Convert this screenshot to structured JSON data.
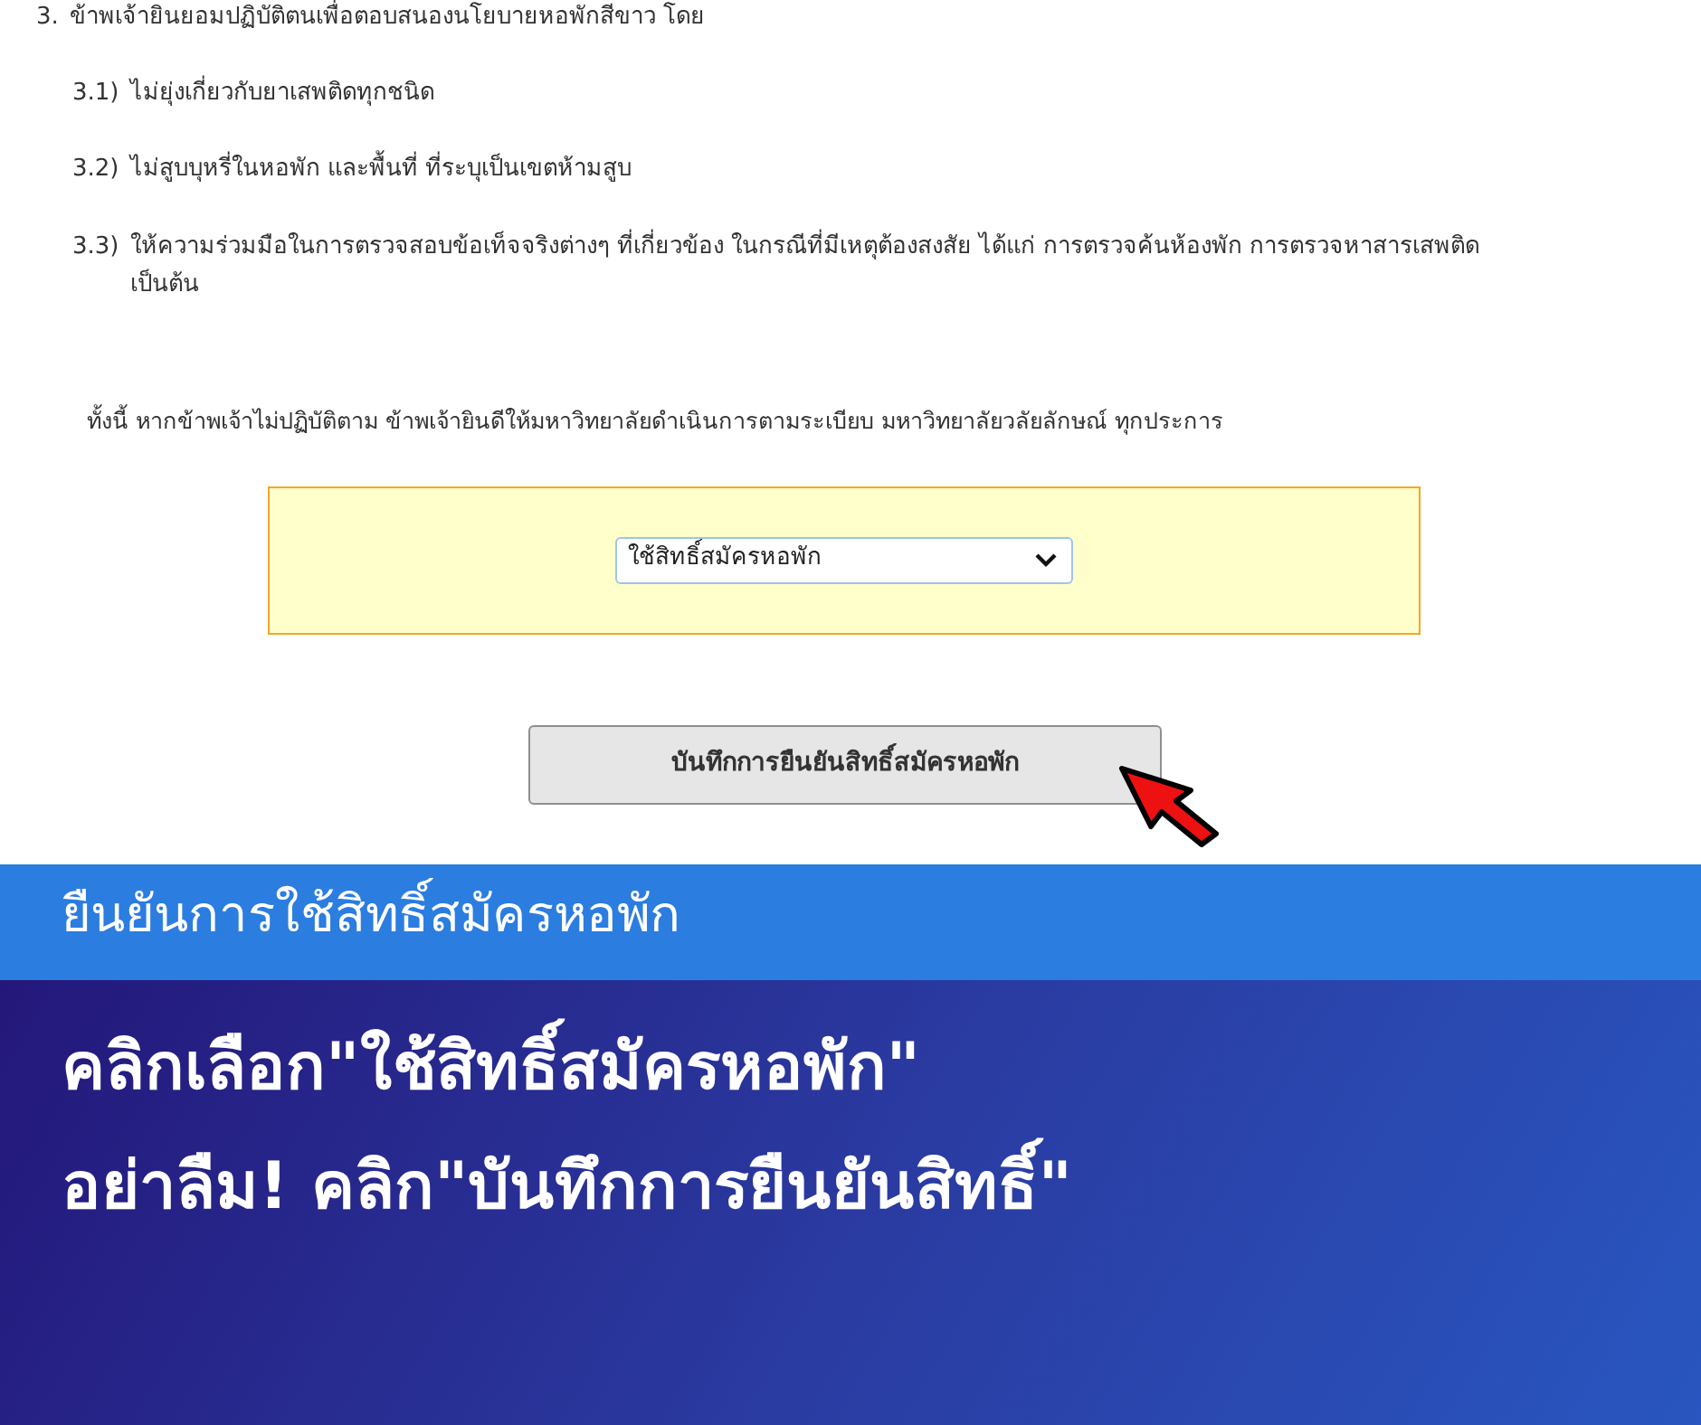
{
  "document": {
    "clauses": [
      {
        "number": "3.",
        "text": "ข้าพเจ้ายินยอมปฏิบัติตนเพื่อตอบสนองนโยบายหอพักสีขาว โดย",
        "children": [
          {
            "number": "3.1)",
            "text": "ไม่ยุ่งเกี่ยวกับยาเสพติดทุกชนิด"
          },
          {
            "number": "3.2)",
            "text": "ไม่สูบบุหรี่ในหอพัก และพื้นที่ ที่ระบุเป็นเขตห้ามสูบ"
          },
          {
            "number": "3.3)",
            "text": "ให้ความร่วมมือในการตรวจสอบข้อเท็จจริงต่างๆ ที่เกี่ยวข้อง ในกรณีที่มีเหตุต้องสงสัย ได้แก่ การตรวจค้นห้องพัก การตรวจหาสารเสพติด เป็นต้น"
          }
        ]
      }
    ],
    "note": "ทั้งนี้ หากข้าพเจ้าไม่ปฏิบัติตาม ข้าพเจ้ายินดีให้มหาวิทยาลัยดำเนินการตามระเบียบ มหาวิทยาลัยวลัยลักษณ์ ทุกประการ"
  },
  "form": {
    "dropdown": {
      "value": "ใช้สิทธิ์สมัครหอพัก"
    },
    "submit_button": "บันทึกการยืนยันสิทธิ์สมัครหอพัก"
  },
  "banner": {
    "subtitle": "ยืนยันการใช้สิทธิ์สมัครหอพัก",
    "headline": [
      "คลิกเลือก\"ใช้สิทธิ์สมัครหอพัก\"",
      "อย่าลืม! คลิก\"บันทึกการยืนยันสิทธิ์\""
    ]
  }
}
